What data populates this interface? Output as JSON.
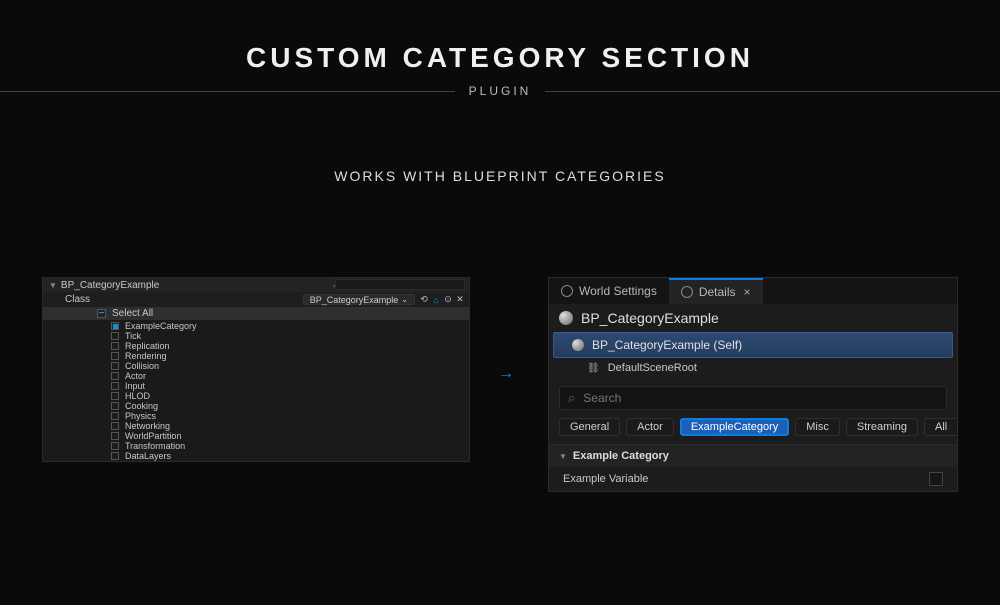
{
  "header": {
    "title": "CUSTOM CATEGORY SECTION",
    "subtitle": "PLUGIN",
    "tagline": "WORKS WITH BLUEPRINT CATEGORIES"
  },
  "arrow_glyph": "→",
  "left": {
    "header_label": "BP_CategoryExample",
    "class_label": "Class",
    "dropdown_label": "BP_CategoryExample",
    "select_all": "Select All",
    "items": [
      {
        "label": "ExampleCategory",
        "checked": true
      },
      {
        "label": "Tick",
        "checked": false
      },
      {
        "label": "Replication",
        "checked": false
      },
      {
        "label": "Rendering",
        "checked": false
      },
      {
        "label": "Collision",
        "checked": false
      },
      {
        "label": "Actor",
        "checked": false
      },
      {
        "label": "Input",
        "checked": false
      },
      {
        "label": "HLOD",
        "checked": false
      },
      {
        "label": "Cooking",
        "checked": false
      },
      {
        "label": "Physics",
        "checked": false
      },
      {
        "label": "Networking",
        "checked": false
      },
      {
        "label": "WorldPartition",
        "checked": false
      },
      {
        "label": "Transformation",
        "checked": false
      },
      {
        "label": "DataLayers",
        "checked": false
      }
    ]
  },
  "right": {
    "tabs": [
      {
        "label": "World Settings",
        "active": false
      },
      {
        "label": "Details",
        "active": true
      }
    ],
    "close_glyph": "×",
    "component_name": "BP_CategoryExample",
    "selected_row": "BP_CategoryExample (Self)",
    "scene_root": "DefaultSceneRoot",
    "search_placeholder": "Search",
    "filters": [
      {
        "label": "General",
        "active": false
      },
      {
        "label": "Actor",
        "active": false
      },
      {
        "label": "ExampleCategory",
        "active": true
      },
      {
        "label": "Misc",
        "active": false
      },
      {
        "label": "Streaming",
        "active": false
      },
      {
        "label": "All",
        "active": false
      }
    ],
    "category_header": "Example Category",
    "variable_name": "Example Variable"
  }
}
